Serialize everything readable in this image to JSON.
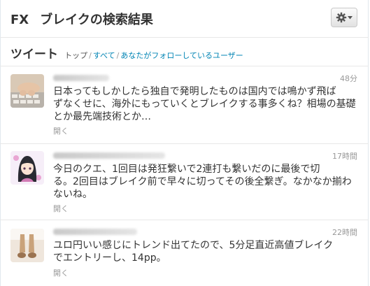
{
  "header": {
    "query": "FX",
    "title": "ブレイクの検索結果",
    "settings_icon": "gear-icon",
    "dropdown_icon": "caret-down-icon"
  },
  "tweets_section": {
    "heading": "ツイート",
    "nav": {
      "top": "トップ",
      "separator": "/",
      "all": "すべて",
      "following": "あなたがフォローしているユーザー"
    }
  },
  "tweets": [
    {
      "time": "48分",
      "text": "日本ってもしかしたら独自で発明したものは国内では鳴かず飛ば\nずなくせに、海外にもっていくとブレイクする事多くね？相場の基礎\nとか最先端技術とか…",
      "open_label": "開く"
    },
    {
      "time": "17時間",
      "text": "今日のクエ、1回目は発狂繋いで2連打も繋いだのに最後で切\nる。2回目はブレイク前で早々に切ってその後全繋ぎ。なかなか揃わ\nないね。",
      "open_label": "開く"
    },
    {
      "time": "22時間",
      "text": "ユロ円いい感じにトレンド出てたので、5分足直近高値ブレイク\nでエントリーし、14pp。",
      "open_label": "開く"
    }
  ],
  "colors": {
    "link": "#0084b4",
    "text": "#333333",
    "muted": "#999999"
  }
}
